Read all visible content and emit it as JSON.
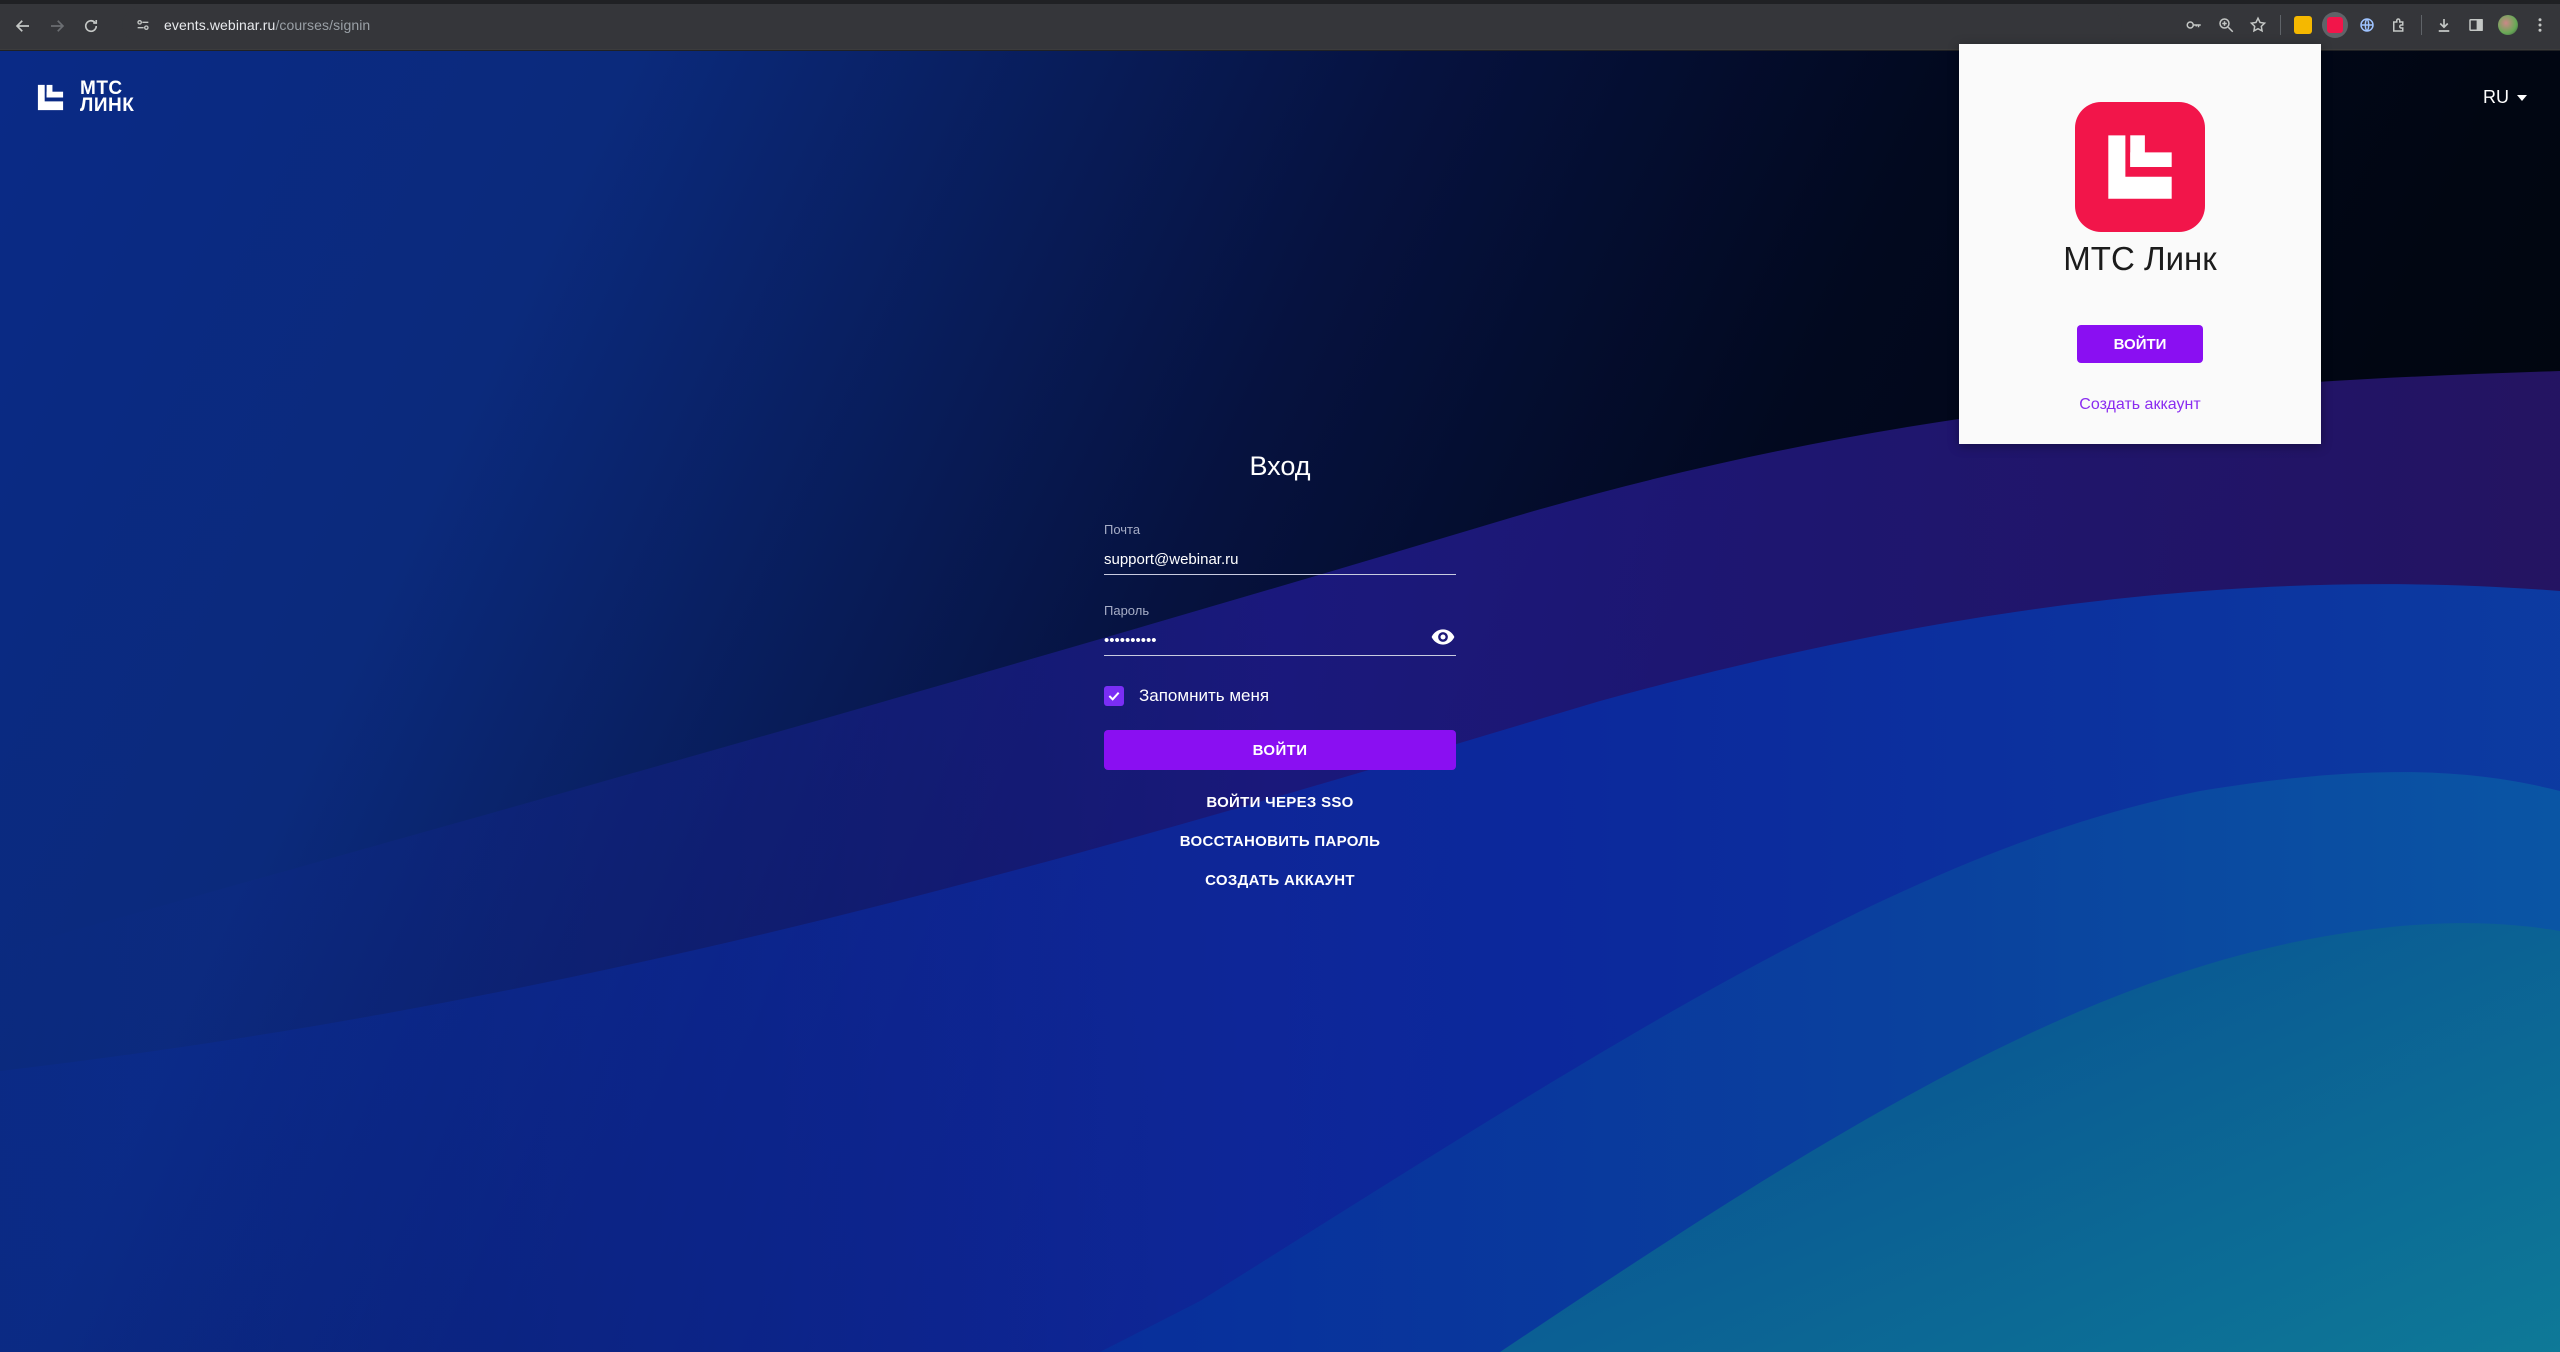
{
  "browser": {
    "url_host": "events.webinar.ru",
    "url_path": "/courses/signin"
  },
  "header": {
    "logo_line1": "МТС",
    "logo_line2": "ЛИНК",
    "language": "RU"
  },
  "login": {
    "title": "Вход",
    "email_label": "Почта",
    "email_value": "support@webinar.ru",
    "password_label": "Пароль",
    "password_value": "••••••••••",
    "remember_label": "Запомнить меня",
    "remember_checked": true,
    "submit_label": "ВОЙТИ",
    "sso_label": "ВОЙТИ ЧЕРЕЗ SSO",
    "recover_label": "ВОССТАНОВИТЬ ПАРОЛЬ",
    "create_label": "СОЗДАТЬ АККАУНТ"
  },
  "popup": {
    "title": "МТС Линк",
    "login_label": "ВОЙТИ",
    "create_label": "Создать аккаунт"
  },
  "colors": {
    "accent": "#8a0ff2",
    "brand_red": "#f2154a"
  }
}
